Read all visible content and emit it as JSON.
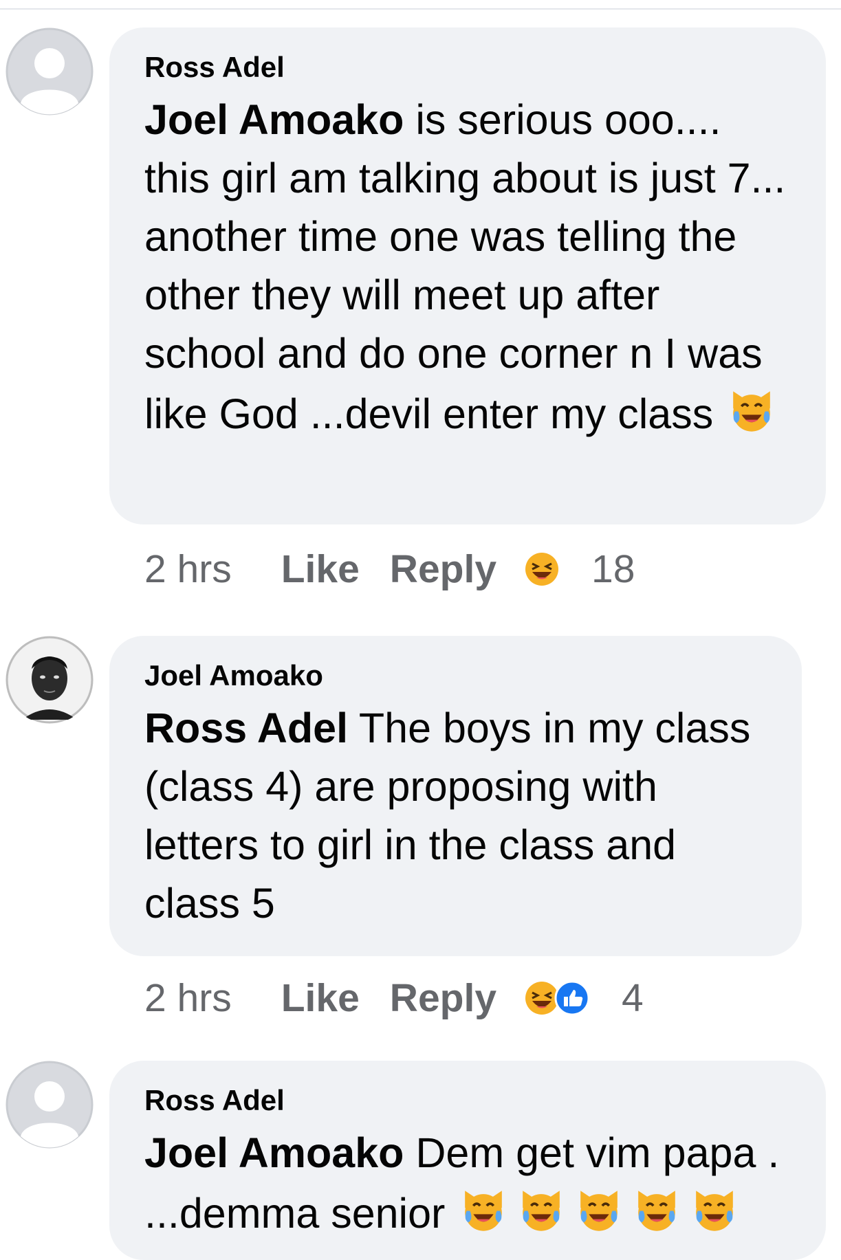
{
  "comments": [
    {
      "author": "Ross Adel",
      "mention": "Joel Amoako",
      "text": " is serious ooo.... this girl am talking about is just 7... another time one was telling the other they will meet up after school and do one corner n I was like God ...devil enter my class ",
      "emoji": "crying-laughing-cat",
      "time": "2 hrs",
      "like_label": "Like",
      "reply_label": "Reply",
      "reactions": [
        "haha"
      ],
      "reaction_count": "18"
    },
    {
      "author": "Joel Amoako",
      "mention": "Ross Adel",
      "text": " The boys in my class (class 4) are proposing with letters to girl in the class and class 5",
      "time": "2 hrs",
      "like_label": "Like",
      "reply_label": "Reply",
      "reactions": [
        "haha",
        "like"
      ],
      "reaction_count": "4"
    },
    {
      "author": "Ross Adel",
      "mention": "Joel Amoako",
      "text": " Dem get vim papa . ...demma senior ",
      "emoji": "crying-laughing-cat",
      "emoji_count": 5
    }
  ],
  "colors": {
    "bubble": "#f0f2f5",
    "meta_text": "#65676b",
    "like_blue": "#1877f2",
    "haha_yellow": "#f7b125"
  }
}
